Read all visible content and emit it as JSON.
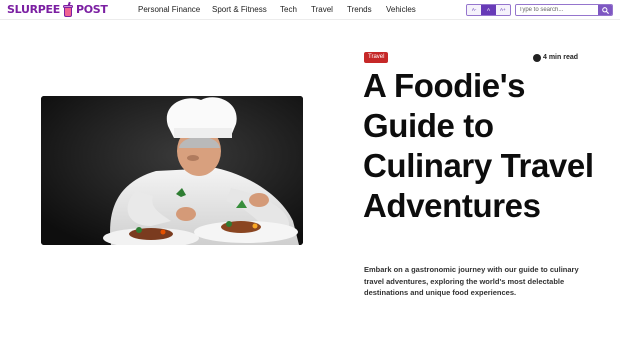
{
  "site": {
    "logo_left": "SLURPEE",
    "logo_right": "POST"
  },
  "nav": {
    "items": [
      {
        "label": "Personal Finance"
      },
      {
        "label": "Sport & Fitness"
      },
      {
        "label": "Tech"
      },
      {
        "label": "Travel"
      },
      {
        "label": "Trends"
      },
      {
        "label": "Vehicles"
      }
    ]
  },
  "font_size_toggle": {
    "decrease": "A-",
    "reset": "A",
    "increase": "A+"
  },
  "search": {
    "placeholder": "Type to search...",
    "icon": "search-icon"
  },
  "article": {
    "category": "Travel",
    "read_time": "4 min read",
    "title": "A Foodie's Guide to Culinary Travel Adventures",
    "description": "Embark on a gastronomic journey with our guide to culinary travel adventures, exploring the world's most delectable destinations and unique food experiences.",
    "image": "chef-plating-food-photo"
  },
  "colors": {
    "brand": "#7b1fa2",
    "accent": "#673ab7",
    "category_tag": "#c62828"
  }
}
